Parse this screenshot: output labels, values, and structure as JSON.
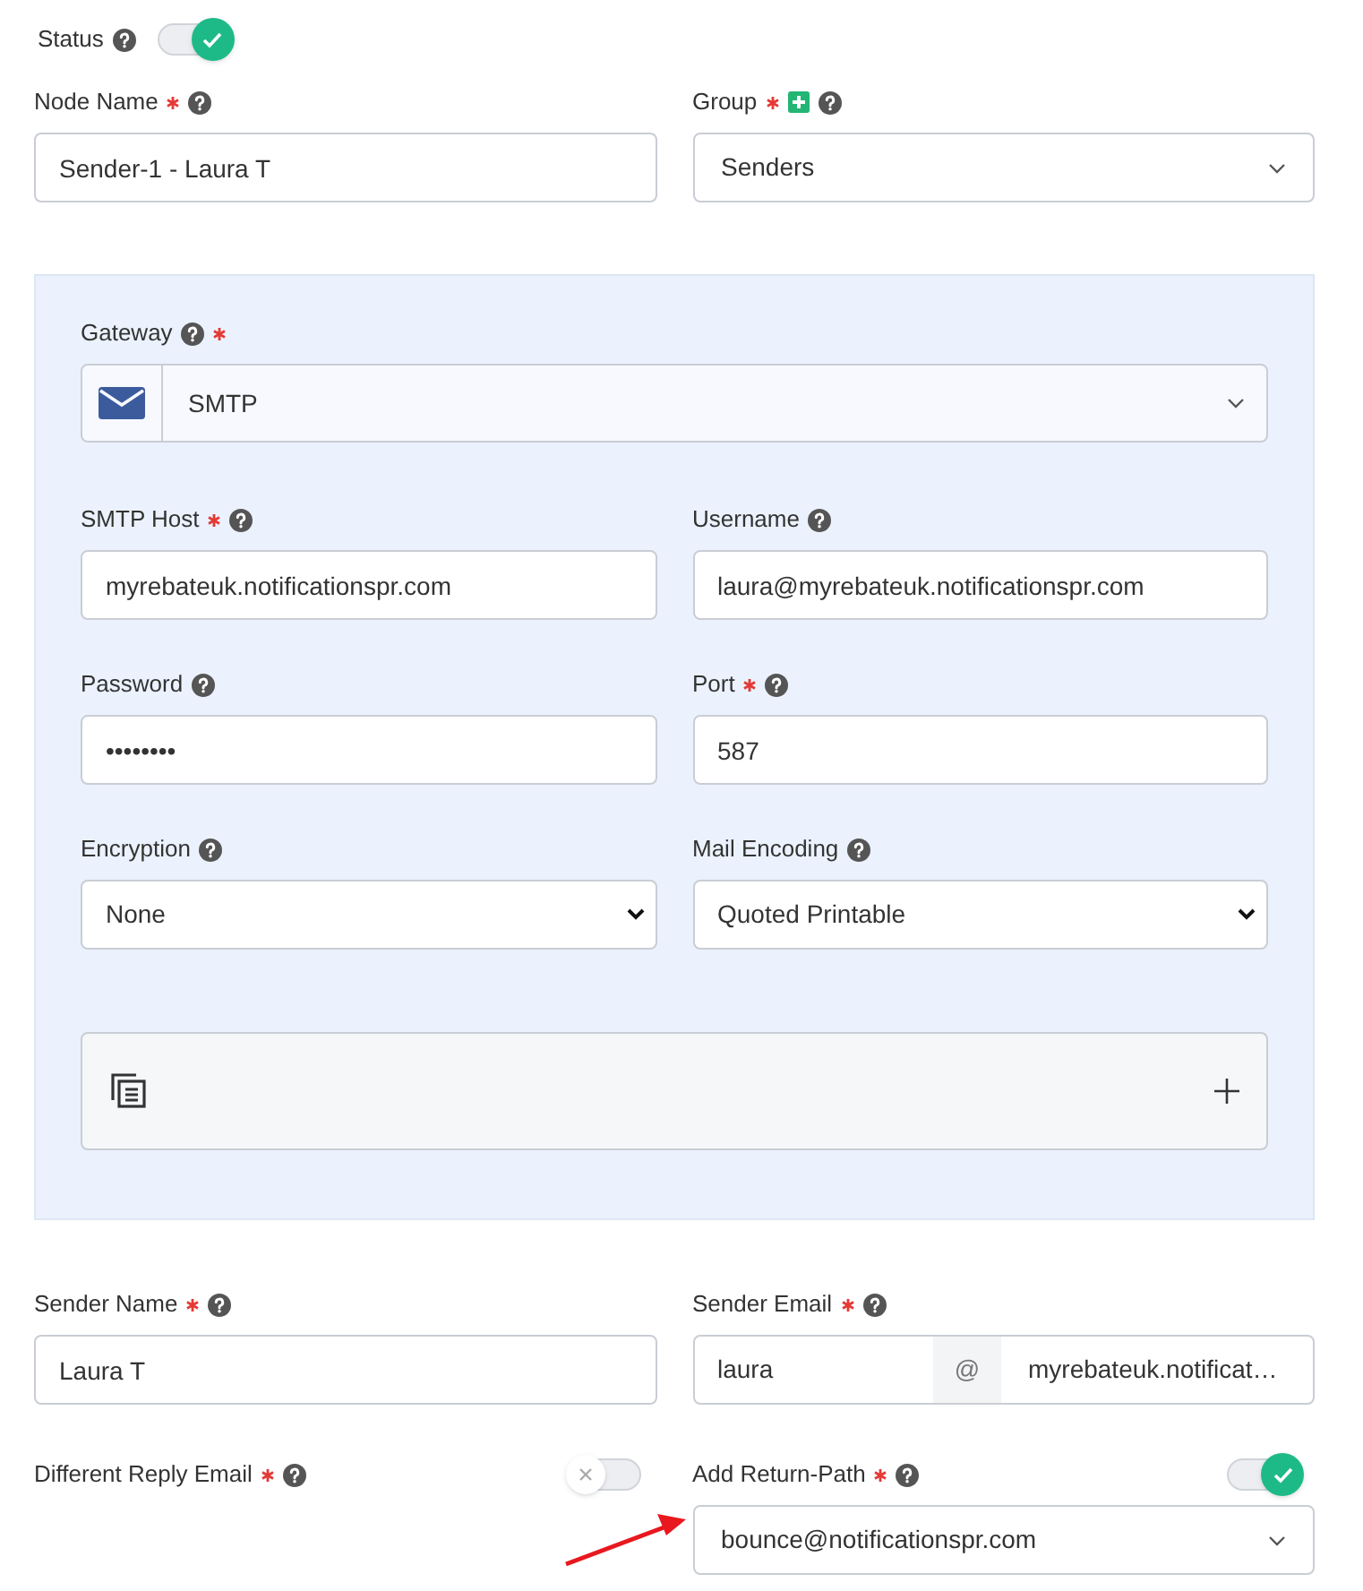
{
  "status": {
    "label": "Status",
    "marks": [
      {
        "kind": "help"
      }
    ],
    "on": true
  },
  "top_fields": [
    {
      "label": "Node Name",
      "marks": [
        {
          "kind": "required"
        },
        {
          "kind": "help"
        }
      ],
      "kind": "text",
      "value": "Sender-1 - Laura T"
    },
    {
      "label": "Group",
      "marks": [
        {
          "kind": "required"
        },
        {
          "kind": "add"
        },
        {
          "kind": "help"
        }
      ],
      "kind": "select",
      "value": "Senders"
    }
  ],
  "gateway": {
    "label": "Gateway",
    "marks": [
      {
        "kind": "help"
      },
      {
        "kind": "required"
      }
    ],
    "value": "SMTP",
    "fields": [
      {
        "label": "SMTP Host",
        "marks": [
          {
            "kind": "required"
          },
          {
            "kind": "help"
          }
        ],
        "kind": "text",
        "value": "myrebateuk.notificationspr.com"
      },
      {
        "label": "Username",
        "marks": [
          {
            "kind": "help"
          }
        ],
        "kind": "text",
        "value": "laura@myrebateuk.notificationspr.com"
      },
      {
        "label": "Password",
        "marks": [
          {
            "kind": "help"
          }
        ],
        "kind": "text",
        "value": "••••••••"
      },
      {
        "label": "Port",
        "marks": [
          {
            "kind": "required"
          },
          {
            "kind": "help"
          }
        ],
        "kind": "text",
        "value": "587"
      },
      {
        "label": "Encryption",
        "marks": [
          {
            "kind": "help"
          }
        ],
        "kind": "native-select",
        "value": "None"
      },
      {
        "label": "Mail Encoding",
        "marks": [
          {
            "kind": "help"
          }
        ],
        "kind": "native-select",
        "value": "Quoted Printable"
      }
    ],
    "attachment_panel": {
      "expanded": false
    }
  },
  "sender_fields": [
    {
      "label": "Sender Name",
      "marks": [
        {
          "kind": "required"
        },
        {
          "kind": "help"
        }
      ],
      "kind": "text",
      "value": "Laura T"
    },
    {
      "label": "Sender Email",
      "marks": [
        {
          "kind": "required"
        },
        {
          "kind": "help"
        }
      ],
      "kind": "email-split",
      "user": "laura",
      "at": "@",
      "domain": "myrebateuk.notificat…"
    }
  ],
  "option_fields": [
    {
      "label": "Different Reply Email",
      "marks": [
        {
          "kind": "required"
        },
        {
          "kind": "help"
        }
      ],
      "on": false
    },
    {
      "label": "Add Return-Path",
      "marks": [
        {
          "kind": "required"
        },
        {
          "kind": "help"
        }
      ],
      "on": true,
      "value": "bounce@notificationspr.com"
    }
  ]
}
